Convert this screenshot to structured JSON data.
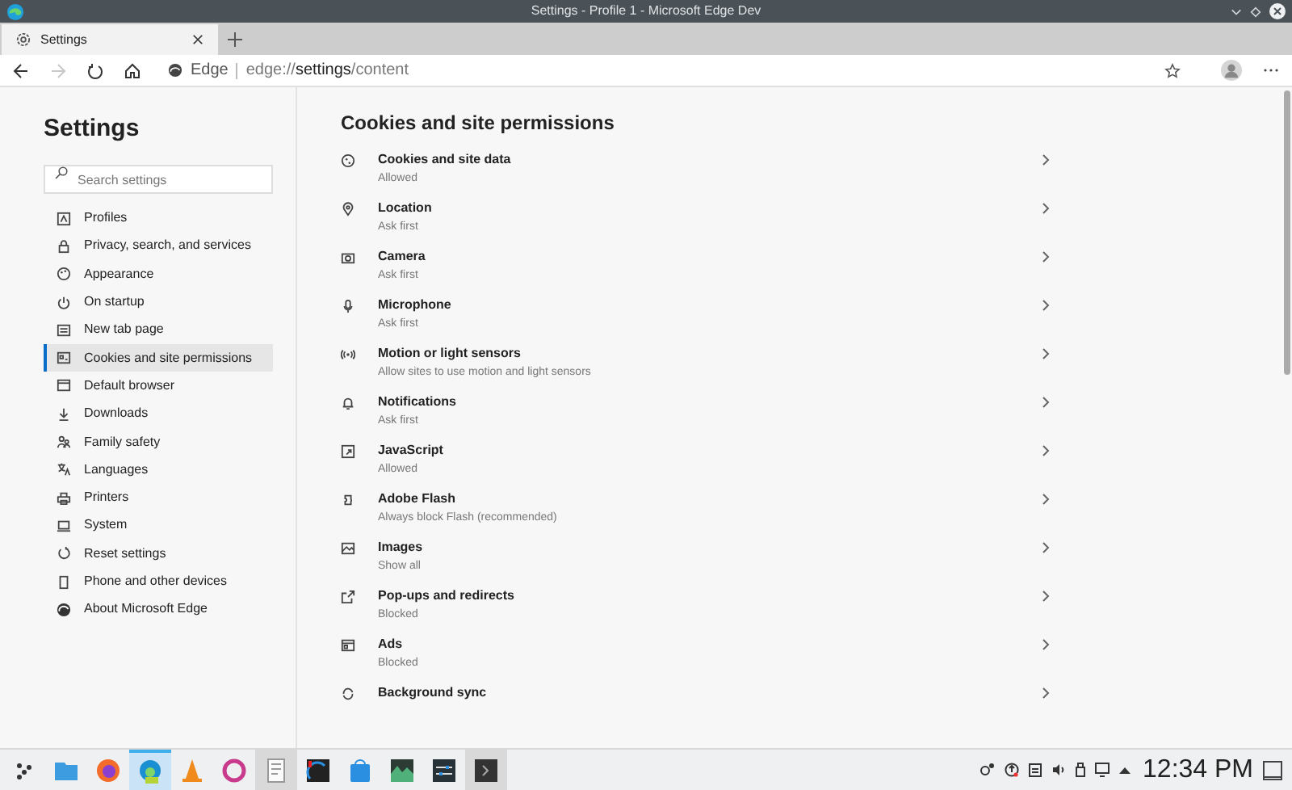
{
  "window": {
    "title": "Settings - Profile 1 - Microsoft Edge Dev"
  },
  "tabs": [
    {
      "label": "Settings",
      "selected": true
    }
  ],
  "address_bar": {
    "site": "Edge",
    "url": "edge://**settings**/content"
  },
  "sidebar": {
    "title": "Settings",
    "search": {
      "placeholder": "Search settings"
    },
    "items": [
      {
        "label": "Profiles",
        "selected": false
      },
      {
        "label": "Privacy, search, and services",
        "selected": false
      },
      {
        "label": "Appearance",
        "selected": false
      },
      {
        "label": "On startup",
        "selected": false
      },
      {
        "label": "New tab page",
        "selected": false
      },
      {
        "label": "Cookies and site permissions",
        "selected": true
      },
      {
        "label": "Default browser",
        "selected": false
      },
      {
        "label": "Downloads",
        "selected": false
      },
      {
        "label": "Family safety",
        "selected": false
      },
      {
        "label": "Languages",
        "selected": false
      },
      {
        "label": "Printers",
        "selected": false
      },
      {
        "label": "System",
        "selected": false
      },
      {
        "label": "Reset settings",
        "selected": false
      },
      {
        "label": "Phone and other devices",
        "selected": false
      },
      {
        "label": "About Microsoft Edge",
        "selected": false
      }
    ]
  },
  "main": {
    "heading": "Cookies and site permissions",
    "permissions": [
      {
        "title": "Cookies and site data",
        "status": "Allowed"
      },
      {
        "title": "Location",
        "status": "Ask first"
      },
      {
        "title": "Camera",
        "status": "Ask first"
      },
      {
        "title": "Microphone",
        "status": "Ask first"
      },
      {
        "title": "Motion or light sensors",
        "status": "Allow sites to use motion and light sensors"
      },
      {
        "title": "Notifications",
        "status": "Ask first"
      },
      {
        "title": "JavaScript",
        "status": "Allowed"
      },
      {
        "title": "Adobe Flash",
        "status": "Always block Flash (recommended)"
      },
      {
        "title": "Images",
        "status": "Show all"
      },
      {
        "title": "Pop-ups and redirects",
        "status": "Blocked"
      },
      {
        "title": "Ads",
        "status": "Blocked"
      },
      {
        "title": "Background sync"
      }
    ]
  },
  "taskbar": {
    "apps": [
      {
        "selected": false
      },
      {
        "selected": false
      },
      {
        "selected": true
      },
      {
        "selected": false
      },
      {
        "selected": false
      },
      {
        "selected": false
      },
      {
        "selected": false
      },
      {
        "selected": false
      },
      {
        "selected": false
      },
      {
        "selected": false
      },
      {
        "selected": false
      }
    ],
    "clock": "12:34 PM"
  }
}
